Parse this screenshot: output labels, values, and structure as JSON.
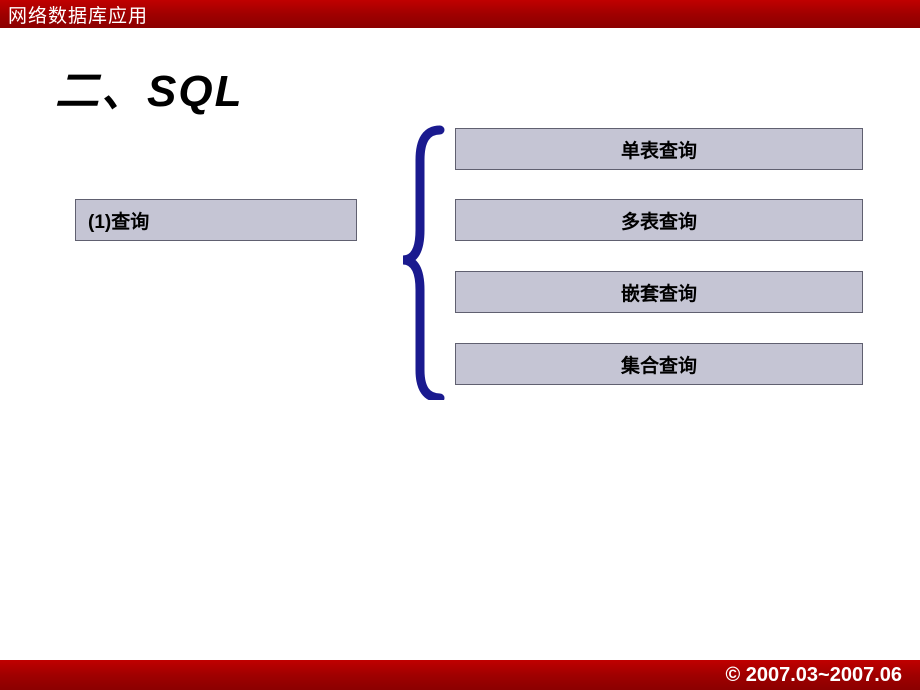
{
  "header": {
    "title": "网络数据库应用"
  },
  "slide": {
    "heading": "二、SQL"
  },
  "topic": {
    "label": "(1)查询"
  },
  "items": [
    {
      "label": "单表查询"
    },
    {
      "label": "多表查询"
    },
    {
      "label": "嵌套查询"
    },
    {
      "label": "集合查询"
    }
  ],
  "footer": {
    "copyright": "© 2007.03~2007.06"
  },
  "colors": {
    "headerBg": "#b00000",
    "boxBg": "#c5c5d4",
    "boxBorder": "#606070",
    "braceColor": "#1a1a8f"
  }
}
